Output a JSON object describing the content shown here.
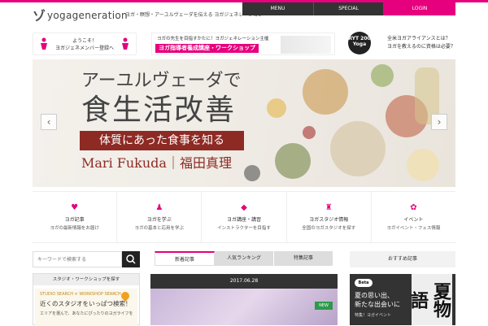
{
  "header": {
    "logo_mark": "ゾ",
    "logo_text": "yogageneration",
    "tagline": "ヨガ・瞑想・アーユルヴェーダを伝える ヨガジェネレーション"
  },
  "nav": {
    "menu": "MENU",
    "special": "SPECIAL",
    "login": "LOGIN"
  },
  "welcome": {
    "line1": "ようこそ！",
    "line2": "ヨガジェネメンバー登録へ"
  },
  "workshop": {
    "line1": "ヨガの先生を目指すかたに！ヨガジェネレーション主催",
    "line2": "ヨガ指導者養成講座・ワークショップ"
  },
  "ryt": {
    "badge": "RYT 200",
    "badge_sub": "Yoga",
    "line1": "全米ヨガアライアンスとは？",
    "line2": "ヨガを教えるのに資格は必要？"
  },
  "hero": {
    "line1": "アーユルヴェーダで",
    "line2": "食生活改善",
    "line3": "体質にあった食事を知る",
    "line4": "Mari Fukuda｜福田真理",
    "prev": "‹",
    "next": "›"
  },
  "categories": [
    {
      "name": "ヨガ記事",
      "sub": "ヨガの最新情報をお届け",
      "icon": "♥"
    },
    {
      "name": "ヨガを学ぶ",
      "sub": "ヨガの基本と応用を学ぶ",
      "icon": "♟"
    },
    {
      "name": "ヨガ講座・講習",
      "sub": "インストラクターを目指す",
      "icon": "◆"
    },
    {
      "name": "ヨガスタジオ情報",
      "sub": "全国のヨガスタジオを探す",
      "icon": "♜"
    },
    {
      "name": "イベント",
      "sub": "ヨガイベント・フェス情報",
      "icon": "✿"
    }
  ],
  "search": {
    "placeholder": "キーワードで検索する"
  },
  "tabs": [
    {
      "label": "新着記事"
    },
    {
      "label": "人気ランキング"
    },
    {
      "label": "特集記事"
    }
  ],
  "right_head": "おすすめ記事",
  "left_panel": {
    "header": "スタジオ・ワークショップを探す",
    "tag": "STUDIO SEARCH × WORKSHOP SEARCH",
    "title": "近くのスタジオをいっぱつ検索！",
    "desc": "エリアを選んで、あなたにぴったりのヨガライフを"
  },
  "feature": {
    "date": "2017.06.28",
    "tag": "NEW"
  },
  "right_banner": {
    "logo": "Beta",
    "line1": "夏の思い出、",
    "line2": "新たな出会いに",
    "line3": "特集！ヨガイベント",
    "calligraphy": "夏物語"
  }
}
